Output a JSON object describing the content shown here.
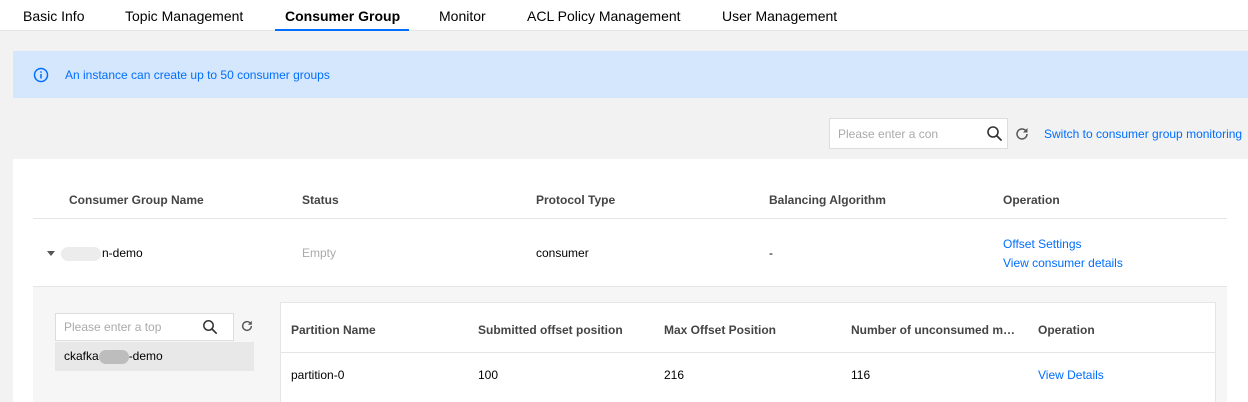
{
  "tabs": [
    {
      "label": "Basic Info",
      "active": false
    },
    {
      "label": "Topic Management",
      "active": false
    },
    {
      "label": "Consumer Group",
      "active": true
    },
    {
      "label": "Monitor",
      "active": false
    },
    {
      "label": "ACL Policy Management",
      "active": false
    },
    {
      "label": "User Management",
      "active": false
    }
  ],
  "notice": {
    "text": "An instance can create up to 50 consumer groups",
    "icon": "info-icon"
  },
  "toolbar": {
    "search_placeholder": "Please enter a con",
    "search_value": "",
    "switch_link": "Switch to consumer group monitoring"
  },
  "table": {
    "headers": [
      "Consumer Group Name",
      "Status",
      "Protocol Type",
      "Balancing Algorithm",
      "Operation"
    ],
    "row": {
      "name_suffix": "n-demo",
      "status": "Empty",
      "protocol": "consumer",
      "algorithm": "-",
      "actions": [
        "Offset Settings",
        "View consumer details"
      ]
    }
  },
  "detail": {
    "topic_search_placeholder": "Please enter a top",
    "topic_search_value": "",
    "topic_prefix": "ckafka",
    "topic_suffix": "-demo",
    "headers": [
      "Partition Name",
      "Submitted offset position",
      "Max Offset Position",
      "Number of unconsumed m…",
      "Operation"
    ],
    "rows": [
      {
        "partition": "partition-0",
        "submitted": "100",
        "max": "216",
        "unconsumed": "116",
        "action": "View Details"
      }
    ]
  },
  "colors": {
    "accent": "#006eff",
    "notice_bg": "#d5e7fd",
    "page_bg": "#f2f2f2"
  }
}
